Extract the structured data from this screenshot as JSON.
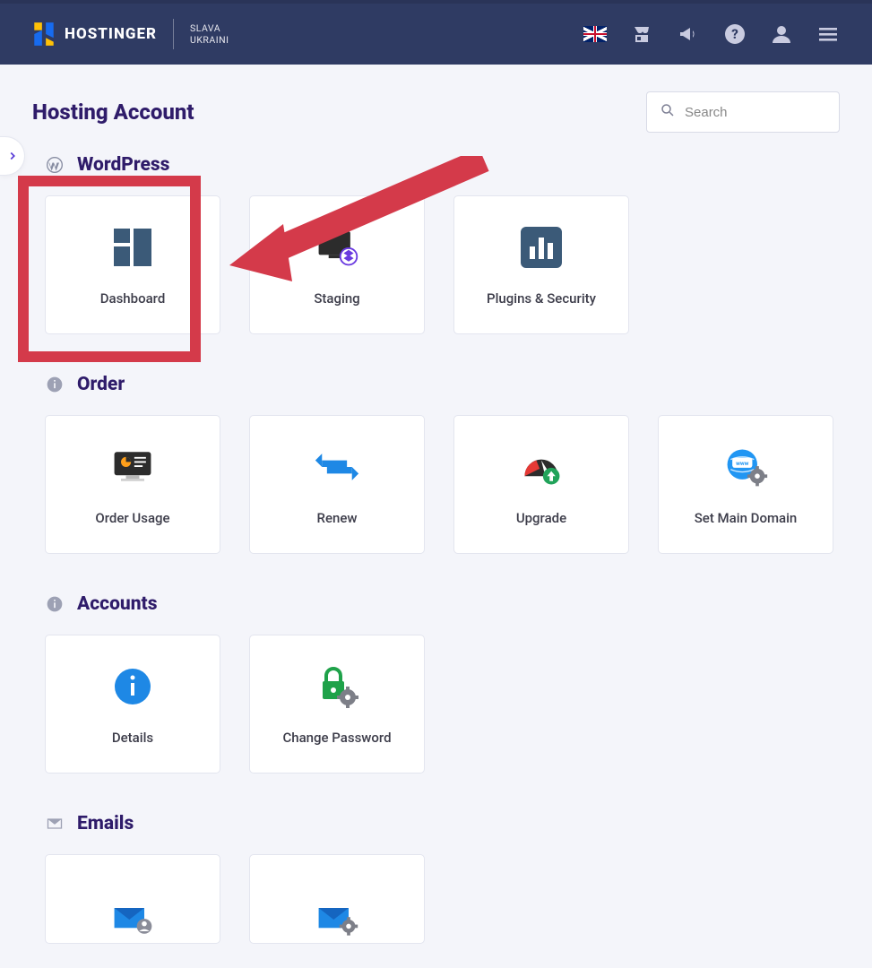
{
  "header": {
    "brand": "HOSTINGER",
    "mottoLine1": "SLAVA",
    "mottoLine2": "UKRAINI"
  },
  "search": {
    "placeholder": "Search"
  },
  "page": {
    "title": "Hosting Account"
  },
  "sections": [
    {
      "id": "wordpress",
      "title": "WordPress",
      "icon": "wordpress",
      "cards": [
        {
          "id": "dashboard",
          "label": "Dashboard",
          "icon": "dashboard",
          "highlighted": true
        },
        {
          "id": "staging",
          "label": "Staging",
          "icon": "staging"
        },
        {
          "id": "plugins-security",
          "label": "Plugins & Security",
          "icon": "bar-chart"
        }
      ]
    },
    {
      "id": "order",
      "title": "Order",
      "icon": "info",
      "cards": [
        {
          "id": "order-usage",
          "label": "Order Usage",
          "icon": "usage-monitor"
        },
        {
          "id": "renew",
          "label": "Renew",
          "icon": "renew-arrows"
        },
        {
          "id": "upgrade",
          "label": "Upgrade",
          "icon": "gauge-up"
        },
        {
          "id": "set-main-domain",
          "label": "Set Main Domain",
          "icon": "globe-gear"
        }
      ]
    },
    {
      "id": "accounts",
      "title": "Accounts",
      "icon": "info",
      "cards": [
        {
          "id": "details",
          "label": "Details",
          "icon": "info-circle"
        },
        {
          "id": "change-password",
          "label": "Change Password",
          "icon": "lock-gear"
        }
      ]
    },
    {
      "id": "emails",
      "title": "Emails",
      "icon": "mail",
      "cards": [
        {
          "id": "email-accounts",
          "label": "",
          "icon": "mail-user"
        },
        {
          "id": "email-settings",
          "label": "",
          "icon": "mail-gear"
        }
      ]
    }
  ],
  "annotation": {
    "arrowColor": "#D43A4A"
  }
}
